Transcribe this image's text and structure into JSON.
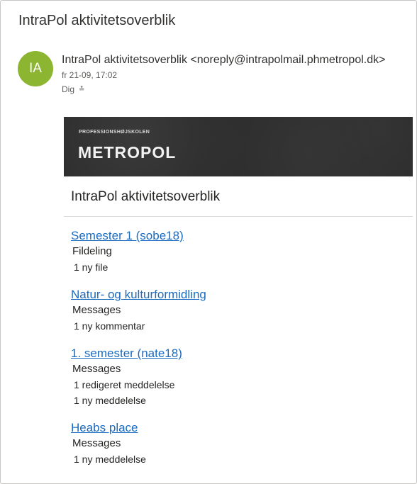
{
  "email": {
    "subject": "IntraPol aktivitetsoverblik",
    "avatar_initials": "IA",
    "avatar_color": "#8cb532",
    "sender": "IntraPol aktivitetsoverblik <noreply@intrapolmail.phmetropol.dk>",
    "date": "fr 21-09, 17:02",
    "to": "Dig",
    "expand_icon": "double-chevron-down-icon"
  },
  "banner": {
    "small_text": "PROFESSIONSHØJSKOLEN",
    "logo_text": "METROPOL"
  },
  "body": {
    "title": "IntraPol aktivitetsoverblik",
    "link_color": "#1b6bc0",
    "groups": [
      {
        "link": "Semester 1 (sobe18)",
        "category": "Fildeling",
        "items": [
          "1 ny file"
        ]
      },
      {
        "link": "Natur- og kulturformidling",
        "category": "Messages",
        "items": [
          "1 ny kommentar"
        ]
      },
      {
        "link": "1. semester (nate18)",
        "category": "Messages",
        "items": [
          "1 redigeret meddelelse",
          "1 ny meddelelse"
        ]
      },
      {
        "link": "Heabs place",
        "category": "Messages",
        "items": [
          "1 ny meddelelse"
        ]
      }
    ]
  }
}
